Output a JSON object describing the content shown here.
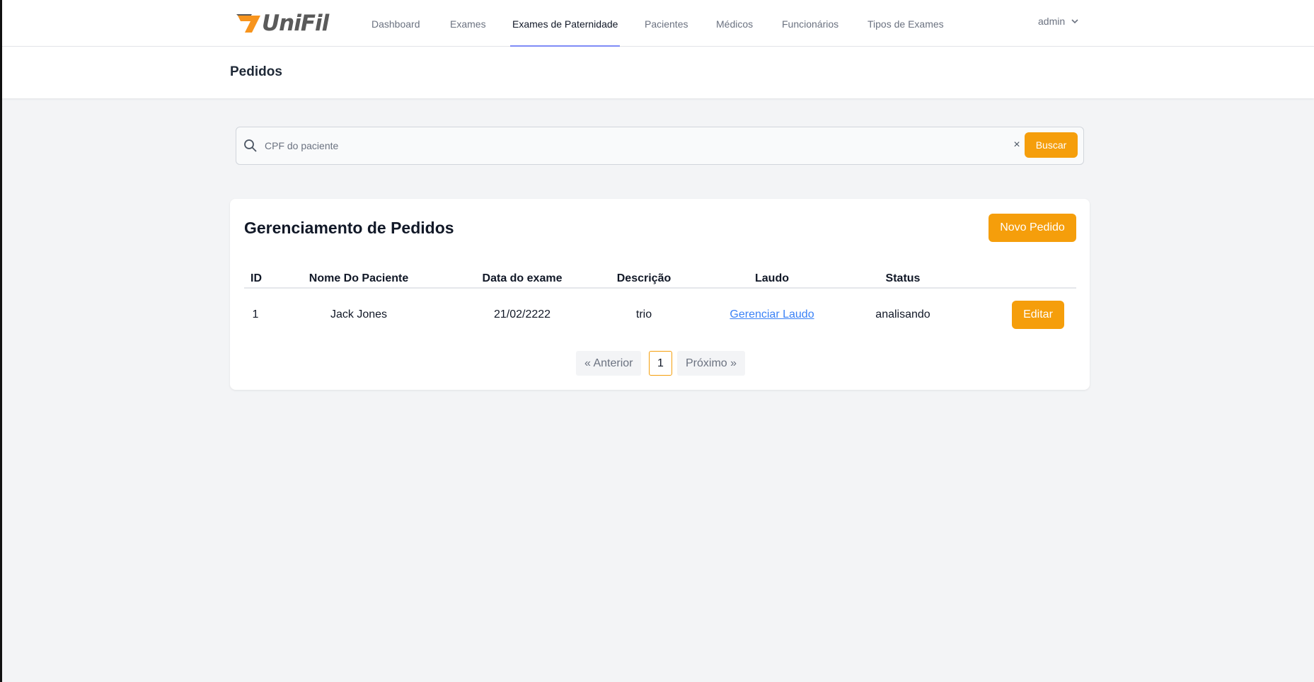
{
  "app": {
    "brand": "UniFil",
    "brand_accent": "#f7941d",
    "accent": "#f59e0b"
  },
  "nav": {
    "items": [
      {
        "label": "Dashboard"
      },
      {
        "label": "Exames"
      },
      {
        "label": "Exames de Paternidade",
        "active": true
      },
      {
        "label": "Pacientes"
      },
      {
        "label": "Médicos"
      },
      {
        "label": "Funcionários"
      },
      {
        "label": "Tipos de Exames"
      }
    ],
    "user": "admin"
  },
  "header": {
    "title": "Pedidos"
  },
  "search": {
    "placeholder": "CPF do paciente",
    "value": "",
    "clear_label": "×",
    "button_label": "Buscar"
  },
  "card": {
    "title": "Gerenciamento de Pedidos",
    "new_button": "Novo Pedido",
    "columns": [
      "ID",
      "Nome Do Paciente",
      "Data do exame",
      "Descrição",
      "Laudo",
      "Status"
    ],
    "rows": [
      {
        "id": "1",
        "nome": "Jack Jones",
        "data": "21/02/2222",
        "descricao": "trio",
        "laudo": "Gerenciar Laudo",
        "status": "analisando",
        "action": "Editar"
      }
    ]
  },
  "pagination": {
    "prev": "« Anterior",
    "current": "1",
    "next": "Próximo »"
  }
}
